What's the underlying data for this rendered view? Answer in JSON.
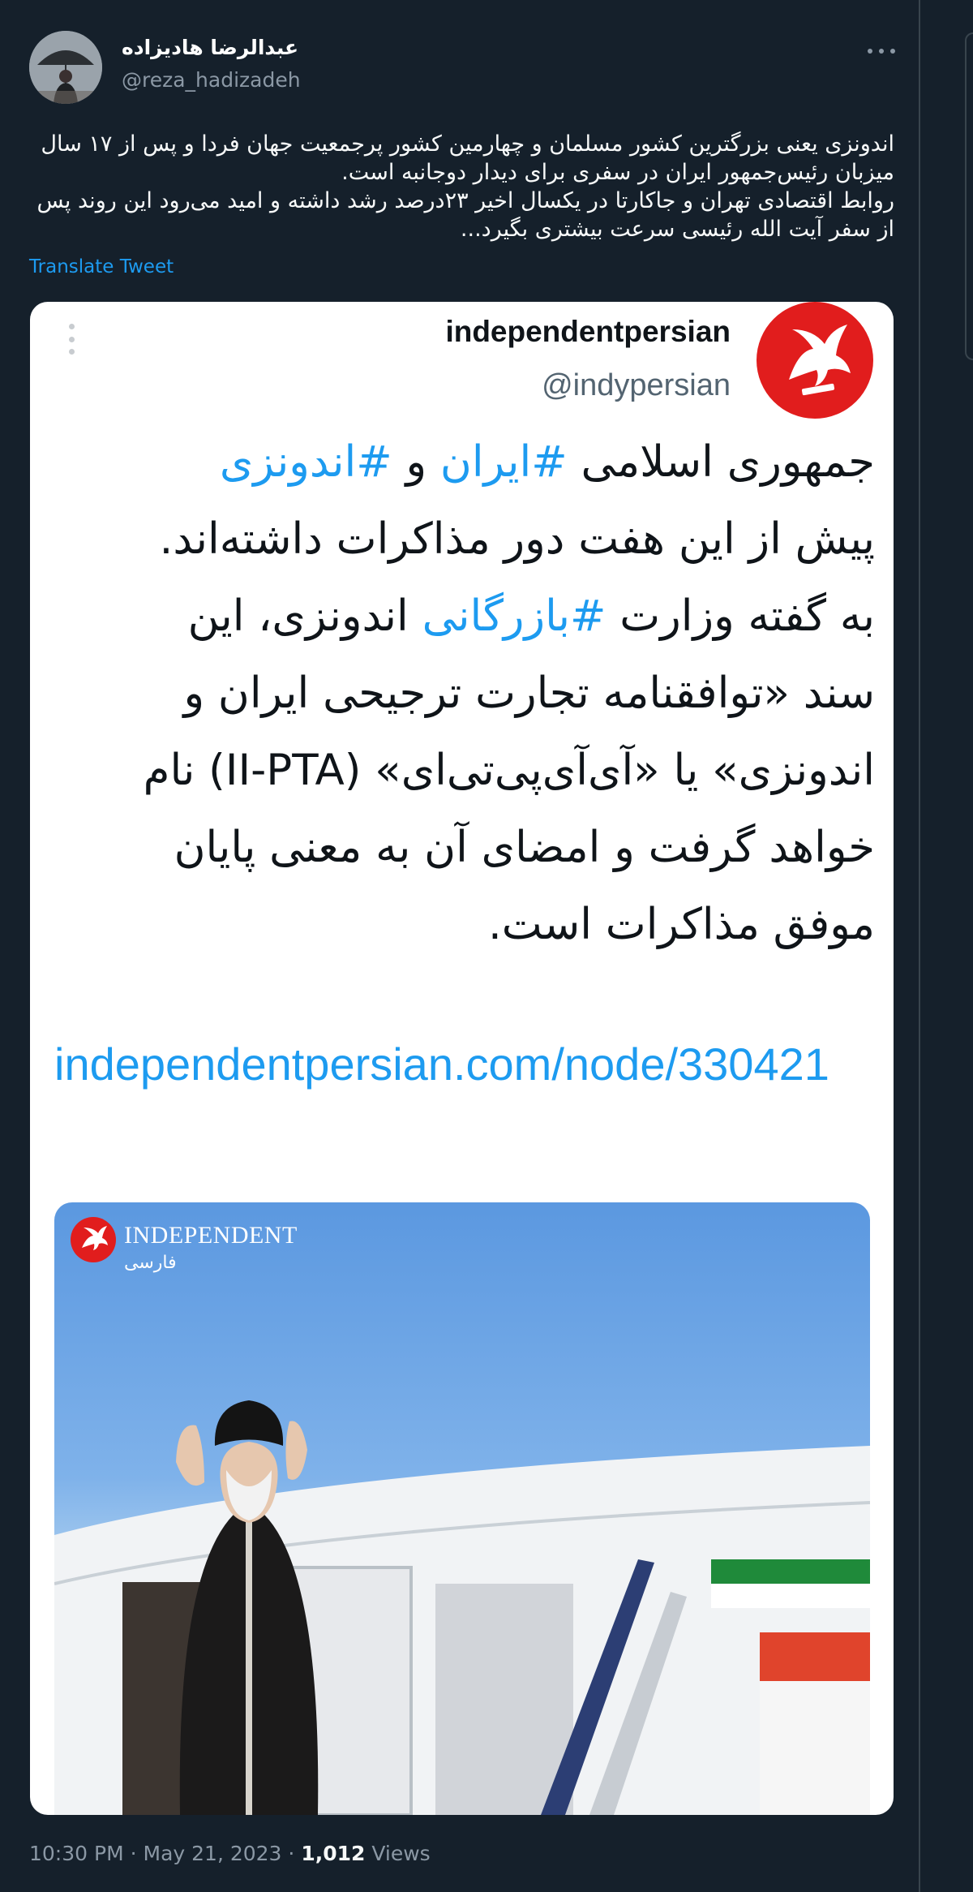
{
  "author": {
    "display_name": "عبدالرضا هادیزاده",
    "handle": "@reza_hadizadeh",
    "avatar_icon": "profile-photo"
  },
  "tweet": {
    "text_lines": [
      "اندونزی یعنی بزرگترین کشور مسلمان و چهارمین کشور پرجمعیت جهان فردا و پس از ۱۷ سال میزبان رئیس‌جمهور ایران در سفری برای دیدار دوجانبه است.",
      "روابط اقتصادی تهران و جاکارتا در یکسال اخیر ۲۳درصد رشد داشته و امید می‌رود این روند پس از سفر آیت الله رئیسی سرعت بیشتری بگیرد..."
    ],
    "translate_label": "Translate Tweet"
  },
  "quoted": {
    "name": "independentpersian",
    "handle": "@indypersian",
    "body": {
      "line1_part1": "جمهوری اسلامی ",
      "line1_tag1": "#ایران",
      "line1_part2": " و ",
      "line1_tag2": "#اندونزی",
      "line2": "پیش از این هفت دور مذاکرات داشته‌اند.",
      "line3_part1": "به گفته وزارت ",
      "line3_tag": "#بازرگانی",
      "line3_part2": " اندونزی، این",
      "line4": "سند «توافقنامه تجارت ترجیحی ایران و",
      "line5": "اندونزی» یا «آی‌آی‌پی‌تی‌ای» (II-PTA) نام",
      "line6": "خواهد گرفت و امضای آن به معنی پایان",
      "line7": "موفق مذاکرات است."
    },
    "link": "independentpersian.com/node/330421",
    "media": {
      "brand": "INDEPENDENT",
      "brand_sub": "فارسی"
    }
  },
  "meta": {
    "time": "10:30 PM",
    "separator": "·",
    "date": "May 21, 2023",
    "views_count": "1,012",
    "views_label": "Views"
  },
  "colors": {
    "background": "#15202b",
    "accent": "#1d9bf0",
    "brand_red": "#e11d1d"
  }
}
